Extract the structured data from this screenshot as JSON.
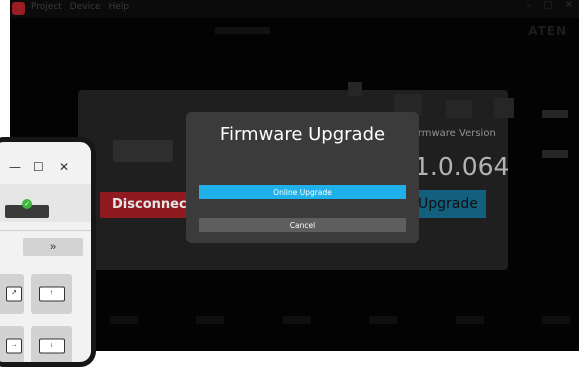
{
  "window": {
    "menu": [
      "Project",
      "Device",
      "Help"
    ],
    "controls": [
      "–",
      "□",
      "✕"
    ],
    "brand": "ATEN"
  },
  "background": {
    "disconnect_label": "Disconnect",
    "firmware_label": "Firmware Version",
    "firmware_version": "1.0.064",
    "upgrade_label": "Upgrade"
  },
  "dialog": {
    "title": "Firmware Upgrade",
    "online_upgrade_label": "Online Upgrade",
    "cancel_label": "Cancel",
    "accent": "#20b0ea"
  },
  "tablet": {
    "controls": [
      "—",
      "☐",
      "✕"
    ],
    "connected_badge": "✓",
    "expand_label": "»",
    "tile_icons": [
      "arrow-up-right-icon",
      "arrow-up-icon",
      "arrow-right-icon",
      "arrow-down-icon"
    ],
    "tile_glyphs": [
      "↗",
      "↑",
      "→",
      "↓"
    ]
  }
}
